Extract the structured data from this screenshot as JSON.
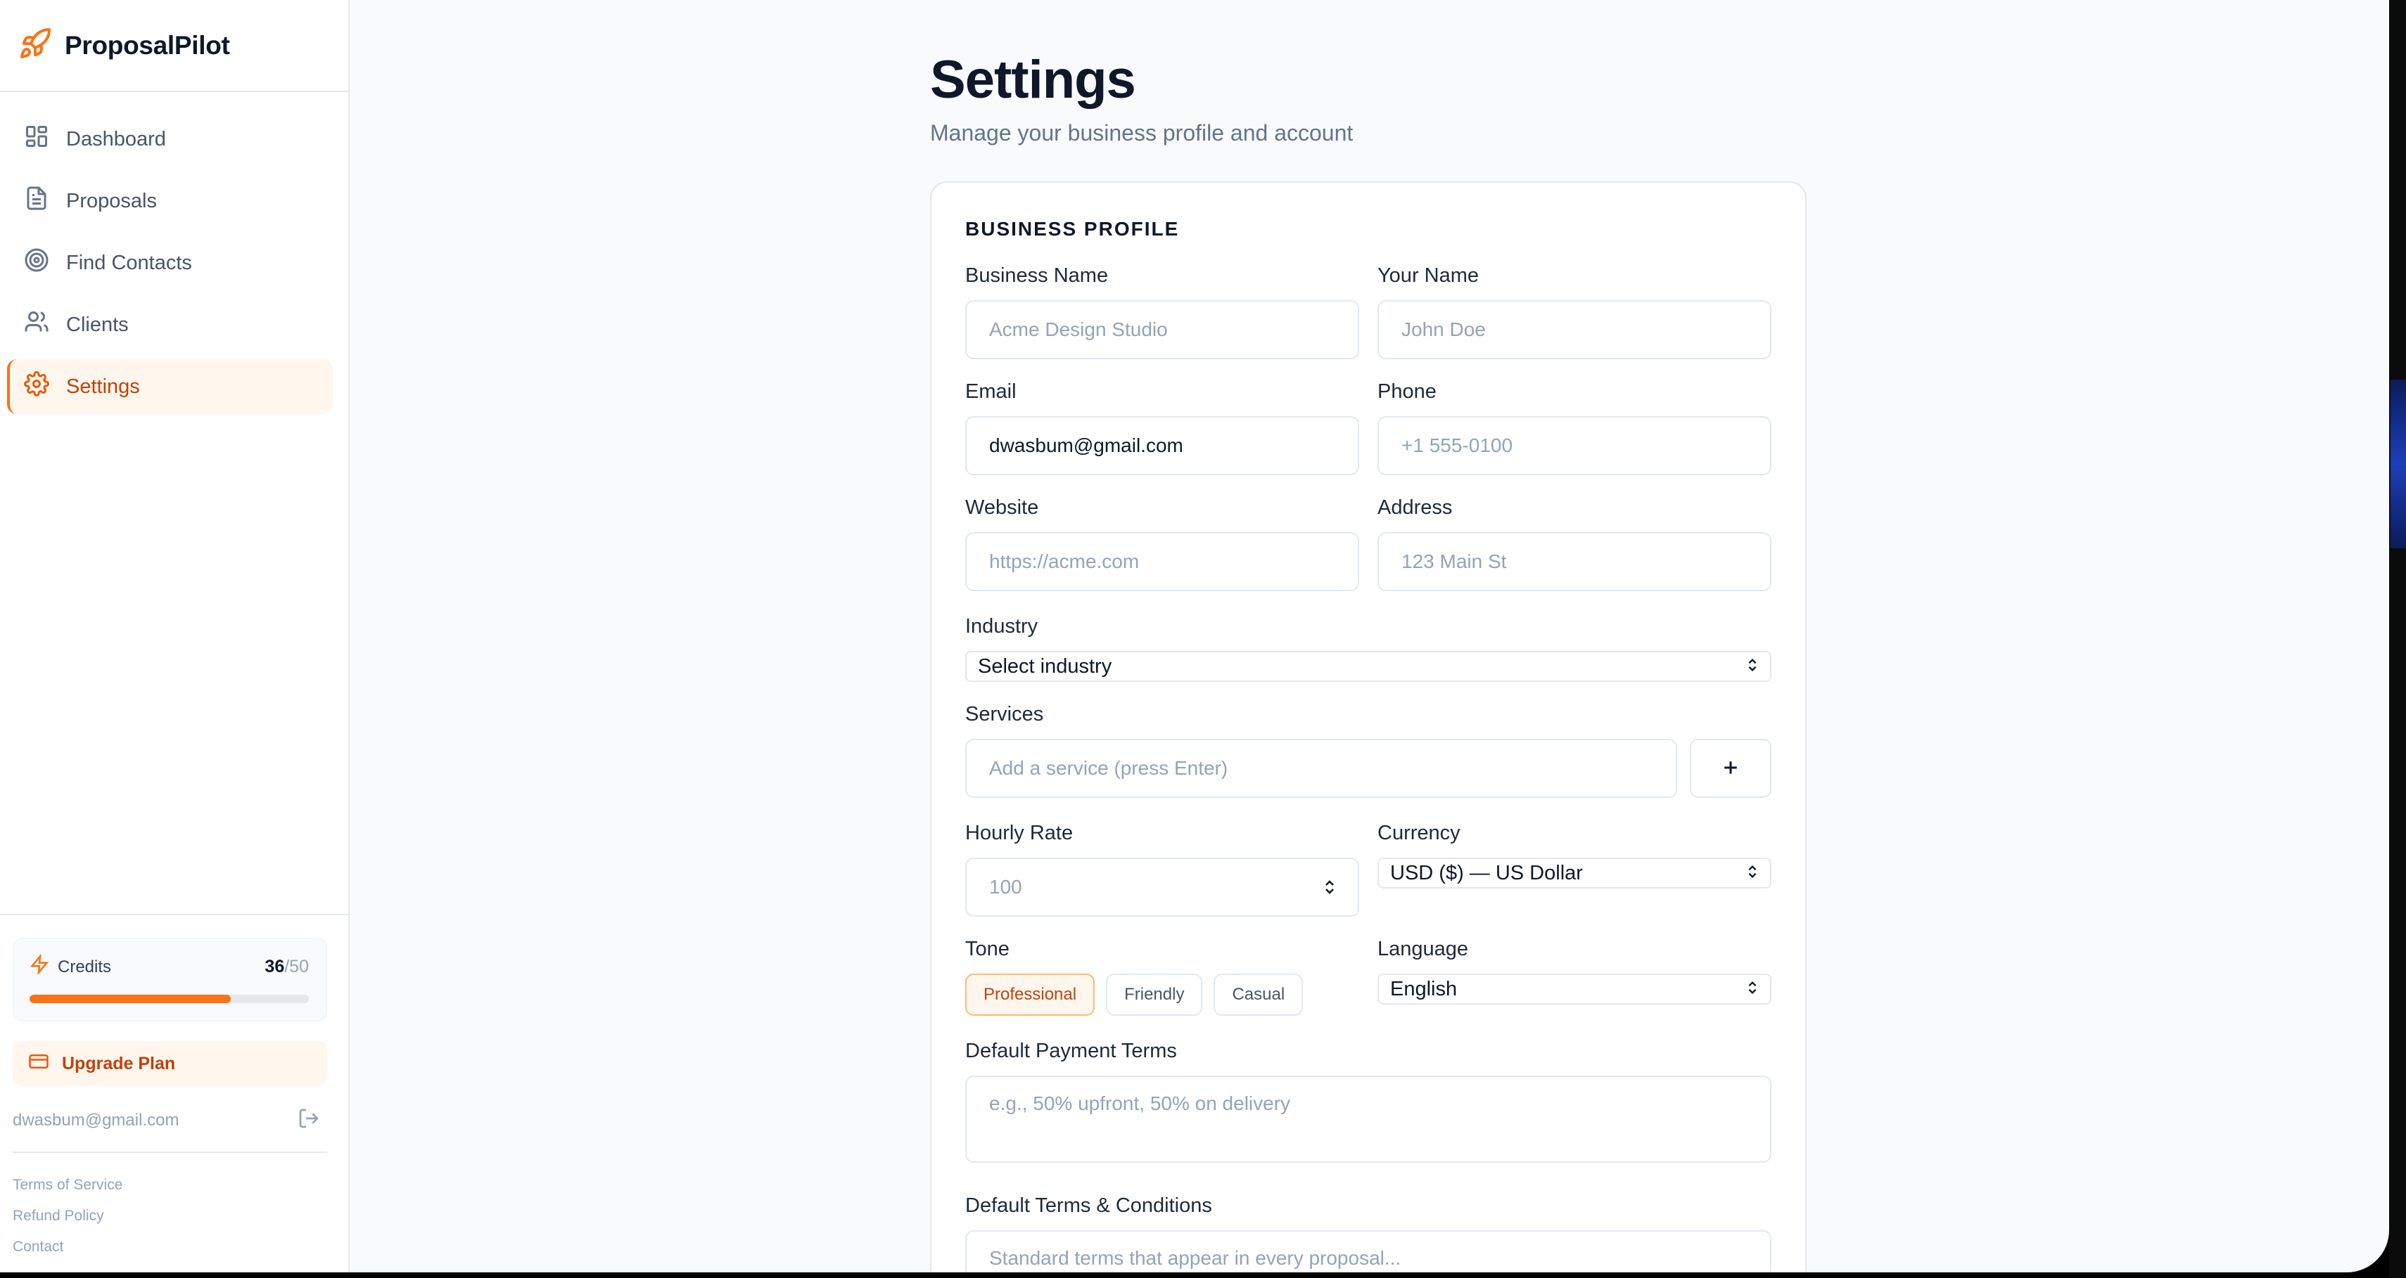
{
  "brand": {
    "name": "ProposalPilot"
  },
  "sidebar": {
    "items": [
      {
        "label": "Dashboard",
        "icon": "dashboard-icon",
        "active": false
      },
      {
        "label": "Proposals",
        "icon": "document-icon",
        "active": false
      },
      {
        "label": "Find Contacts",
        "icon": "target-icon",
        "active": false
      },
      {
        "label": "Clients",
        "icon": "users-icon",
        "active": false
      },
      {
        "label": "Settings",
        "icon": "gear-icon",
        "active": true
      }
    ],
    "credits": {
      "label": "Credits",
      "used": "36",
      "total": "/50",
      "fraction": 0.72
    },
    "upgrade_label": "Upgrade Plan",
    "user_email": "dwasbum@gmail.com",
    "links": [
      "Terms of Service",
      "Refund Policy",
      "Contact"
    ]
  },
  "page": {
    "title": "Settings",
    "subtitle": "Manage your business profile and account"
  },
  "profile": {
    "section_title": "BUSINESS PROFILE",
    "business_name": {
      "label": "Business Name",
      "value": "",
      "placeholder": "Acme Design Studio"
    },
    "your_name": {
      "label": "Your Name",
      "value": "",
      "placeholder": "John Doe"
    },
    "email": {
      "label": "Email",
      "value": "dwasbum@gmail.com",
      "placeholder": ""
    },
    "phone": {
      "label": "Phone",
      "value": "",
      "placeholder": "+1 555-0100"
    },
    "website": {
      "label": "Website",
      "value": "",
      "placeholder": "https://acme.com"
    },
    "address": {
      "label": "Address",
      "value": "",
      "placeholder": "123 Main St"
    },
    "industry": {
      "label": "Industry",
      "selected": "Select industry"
    },
    "services": {
      "label": "Services",
      "placeholder": "Add a service (press Enter)"
    },
    "hourly_rate": {
      "label": "Hourly Rate",
      "placeholder": "100"
    },
    "currency": {
      "label": "Currency",
      "selected": "USD ($) — US Dollar"
    },
    "tone": {
      "label": "Tone",
      "options": [
        "Professional",
        "Friendly",
        "Casual"
      ],
      "selected": "Professional"
    },
    "language": {
      "label": "Language",
      "selected": "English"
    },
    "payment_terms": {
      "label": "Default Payment Terms",
      "placeholder": "e.g., 50% upfront, 50% on delivery"
    },
    "terms_conditions": {
      "label": "Default Terms & Conditions",
      "placeholder": "Standard terms that appear in every proposal..."
    }
  },
  "colors": {
    "accent": "#f97316",
    "accent_dark": "#c2410c",
    "accent_bg": "#fff7ed"
  }
}
